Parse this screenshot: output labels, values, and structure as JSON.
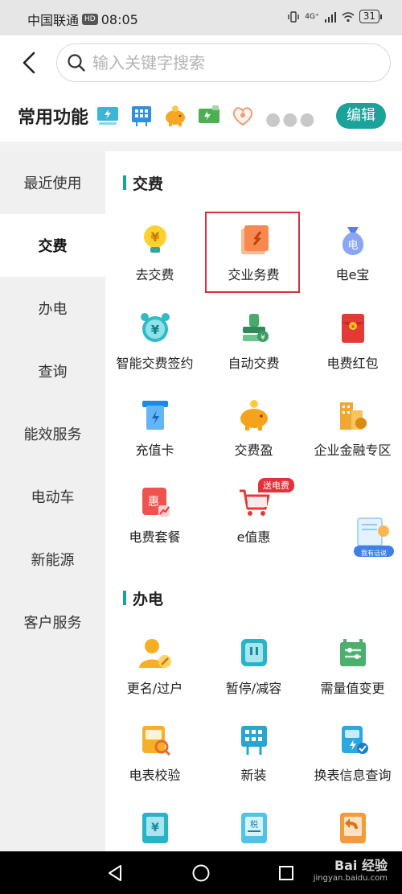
{
  "status_bar": {
    "carrier": "中国联通",
    "hd": "HD",
    "time": "08:05",
    "network": "4G⁺",
    "battery": "31"
  },
  "search": {
    "placeholder": "输入关键字搜索"
  },
  "common": {
    "title": "常用功能",
    "edit_label": "编辑",
    "icons": [
      "screen-icon",
      "building-icon",
      "piggy-bank-icon",
      "green-card-icon",
      "heart-icon"
    ]
  },
  "sidebar": {
    "items": [
      {
        "label": "最近使用",
        "active": false
      },
      {
        "label": "交费",
        "active": true
      },
      {
        "label": "办电",
        "active": false
      },
      {
        "label": "查询",
        "active": false
      },
      {
        "label": "能效服务",
        "active": false
      },
      {
        "label": "电动车",
        "active": false
      },
      {
        "label": "新能源",
        "active": false
      },
      {
        "label": "客户服务",
        "active": false
      }
    ]
  },
  "sections": {
    "pay": {
      "title": "交费",
      "items": [
        {
          "label": "去交费",
          "icon": "yuan-bulb-icon"
        },
        {
          "label": "交业务费",
          "icon": "document-pin-icon"
        },
        {
          "label": "电e宝",
          "icon": "money-bag-icon"
        },
        {
          "label": "智能交费签约",
          "icon": "alarm-yuan-icon"
        },
        {
          "label": "自动交费",
          "icon": "stamp-coin-icon"
        },
        {
          "label": "电费红包",
          "icon": "red-envelope-icon"
        },
        {
          "label": "充值卡",
          "icon": "card-slot-icon"
        },
        {
          "label": "交费盈",
          "icon": "piggy-bank-icon"
        },
        {
          "label": "企业金融专区",
          "icon": "enterprise-building-icon"
        },
        {
          "label": "电费套餐",
          "icon": "package-chart-icon"
        },
        {
          "label": "e值惠",
          "icon": "shopping-cart-icon"
        }
      ],
      "promo_tag": "送电费"
    },
    "apply": {
      "title": "办电",
      "items": [
        {
          "label": "更名/过户",
          "icon": "user-edit-icon"
        },
        {
          "label": "暂停/减容",
          "icon": "meter-pause-icon"
        },
        {
          "label": "需量值变更",
          "icon": "adjust-icon"
        },
        {
          "label": "电表校验",
          "icon": "meter-search-icon"
        },
        {
          "label": "新装",
          "icon": "building-plug-icon"
        },
        {
          "label": "换表信息查询",
          "icon": "meter-check-icon"
        }
      ]
    }
  },
  "float_help": {
    "label": "我有话说"
  },
  "watermark": {
    "brand": "Bai 经验",
    "site": "jingyan.baidu.com"
  },
  "colors": {
    "accent": "#1aa39a",
    "highlight_border": "#d9303a",
    "sidebar_bg": "#f0f0f0"
  }
}
